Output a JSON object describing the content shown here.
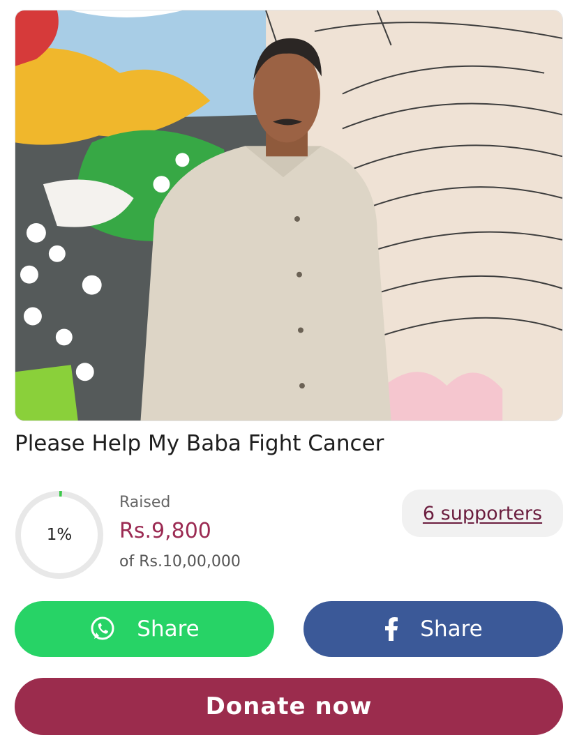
{
  "campaign": {
    "title": "Please Help My Baba Fight Cancer"
  },
  "progress": {
    "percent_label": "1%",
    "fraction": 0.01,
    "raised_label": "Raised",
    "raised_amount": "Rs.9,800",
    "goal": "of Rs.10,00,000"
  },
  "supporters": {
    "label": "6 supporters"
  },
  "actions": {
    "whatsapp_share": "Share",
    "facebook_share": "Share",
    "donate": "Donate now"
  },
  "colors": {
    "accent": "#9b2c4d",
    "whatsapp": "#27d366",
    "facebook": "#3b5998",
    "progress": "#3cc84a"
  },
  "icons": {
    "whatsapp": "whatsapp-icon",
    "facebook": "facebook-icon"
  }
}
